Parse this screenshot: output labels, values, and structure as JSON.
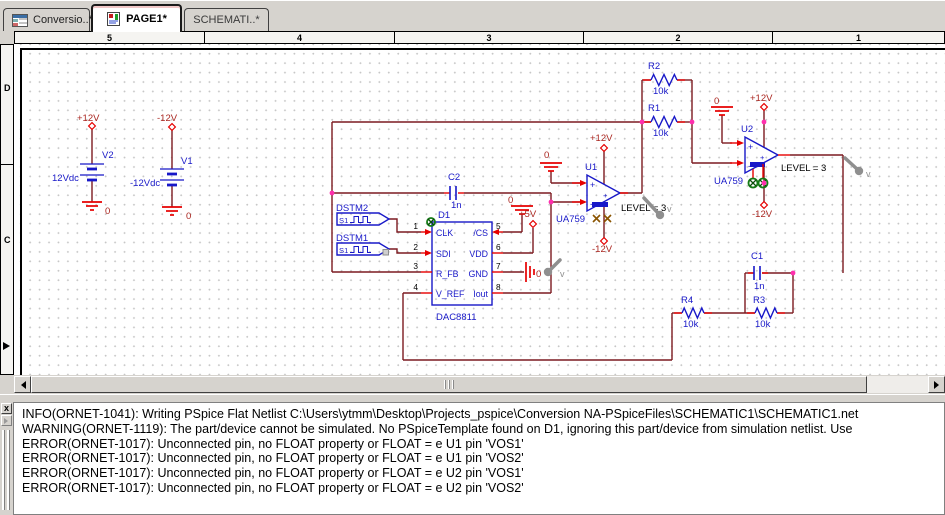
{
  "tabs": {
    "items": [
      {
        "label": "Conversio..*"
      },
      {
        "label": "PAGE1*"
      },
      {
        "label": "SCHEMATI..*"
      }
    ]
  },
  "ruler": {
    "h": [
      "5",
      "4",
      "3",
      "2",
      "1"
    ],
    "v": [
      "D",
      "C"
    ]
  },
  "schematic": {
    "v2": {
      "ref": "V2",
      "value": "12Vdc",
      "power": "+12V",
      "gnd": "0"
    },
    "v1": {
      "ref": "V1",
      "value": "-12Vdc",
      "power": "-12V",
      "gnd": "0"
    },
    "dstm2": {
      "ref": "DSTM2",
      "impl": "S1"
    },
    "dstm1": {
      "ref": "DSTM1",
      "impl": "S1"
    },
    "d1": {
      "ref": "D1",
      "part": "DAC8811",
      "pins_left": [
        {
          "num": "1",
          "name": "CLK"
        },
        {
          "num": "2",
          "name": "SDI"
        },
        {
          "num": "3",
          "name": "R_FB"
        },
        {
          "num": "4",
          "name": "V_REF"
        }
      ],
      "pins_right": [
        {
          "num": "5",
          "name": "/CS"
        },
        {
          "num": "6",
          "name": "VDD"
        },
        {
          "num": "7",
          "name": "GND"
        },
        {
          "num": "8",
          "name": "Iout"
        }
      ],
      "cs_gnd": "0",
      "vdd_power": "+5V",
      "gnd_sym": "0",
      "probe": "v"
    },
    "c2": {
      "ref": "C2",
      "value": "1n"
    },
    "c1": {
      "ref": "C1",
      "value": "1n"
    },
    "r1": {
      "ref": "R1",
      "value": "10k"
    },
    "r2": {
      "ref": "R2",
      "value": "10k"
    },
    "r3": {
      "ref": "R3",
      "value": "10k"
    },
    "r4": {
      "ref": "R4",
      "value": "10k"
    },
    "u1": {
      "ref": "U1",
      "part": "UA759",
      "level": "LEVEL = 3",
      "vplus": "+12V",
      "vminus": "-12V",
      "plus": "+",
      "minus": "-",
      "out_plus": "+",
      "gnd": "0",
      "probe": "v"
    },
    "u2": {
      "ref": "U2",
      "part": "UA759",
      "level": "LEVEL = 3",
      "vplus": "+12V",
      "vminus": "-12V",
      "plus": "+",
      "minus": "-",
      "out_plus": "+",
      "gnd": "0",
      "probe": "v"
    }
  },
  "log": {
    "close_label": "x",
    "lines": [
      "INFO(ORNET-1041): Writing PSpice Flat Netlist C:\\Users\\ytmm\\Desktop\\Projects_pspice\\Conversion NA-PSpiceFiles\\SCHEMATIC1\\SCHEMATIC1.net",
      "WARNING(ORNET-1119): The part/device cannot be simulated. No PSpiceTemplate found on D1, ignoring this part/device from simulation netlist. Use",
      "ERROR(ORNET-1017): Unconnected pin, no FLOAT property or FLOAT = e U1 pin 'VOS1'",
      "ERROR(ORNET-1017): Unconnected pin, no FLOAT property or FLOAT = e U1 pin 'VOS2'",
      "ERROR(ORNET-1017): Unconnected pin, no FLOAT property or FLOAT = e U2 pin 'VOS1'",
      "ERROR(ORNET-1017): Unconnected pin, no FLOAT property or FLOAT = e U2 pin 'VOS2'"
    ]
  },
  "colors": {
    "wire": "#7c1a20",
    "part_blue": "#1818c8",
    "pin_red": "#e60000",
    "junction_pink": "#ff2fae",
    "probe_gray": "#8f8f8f"
  }
}
